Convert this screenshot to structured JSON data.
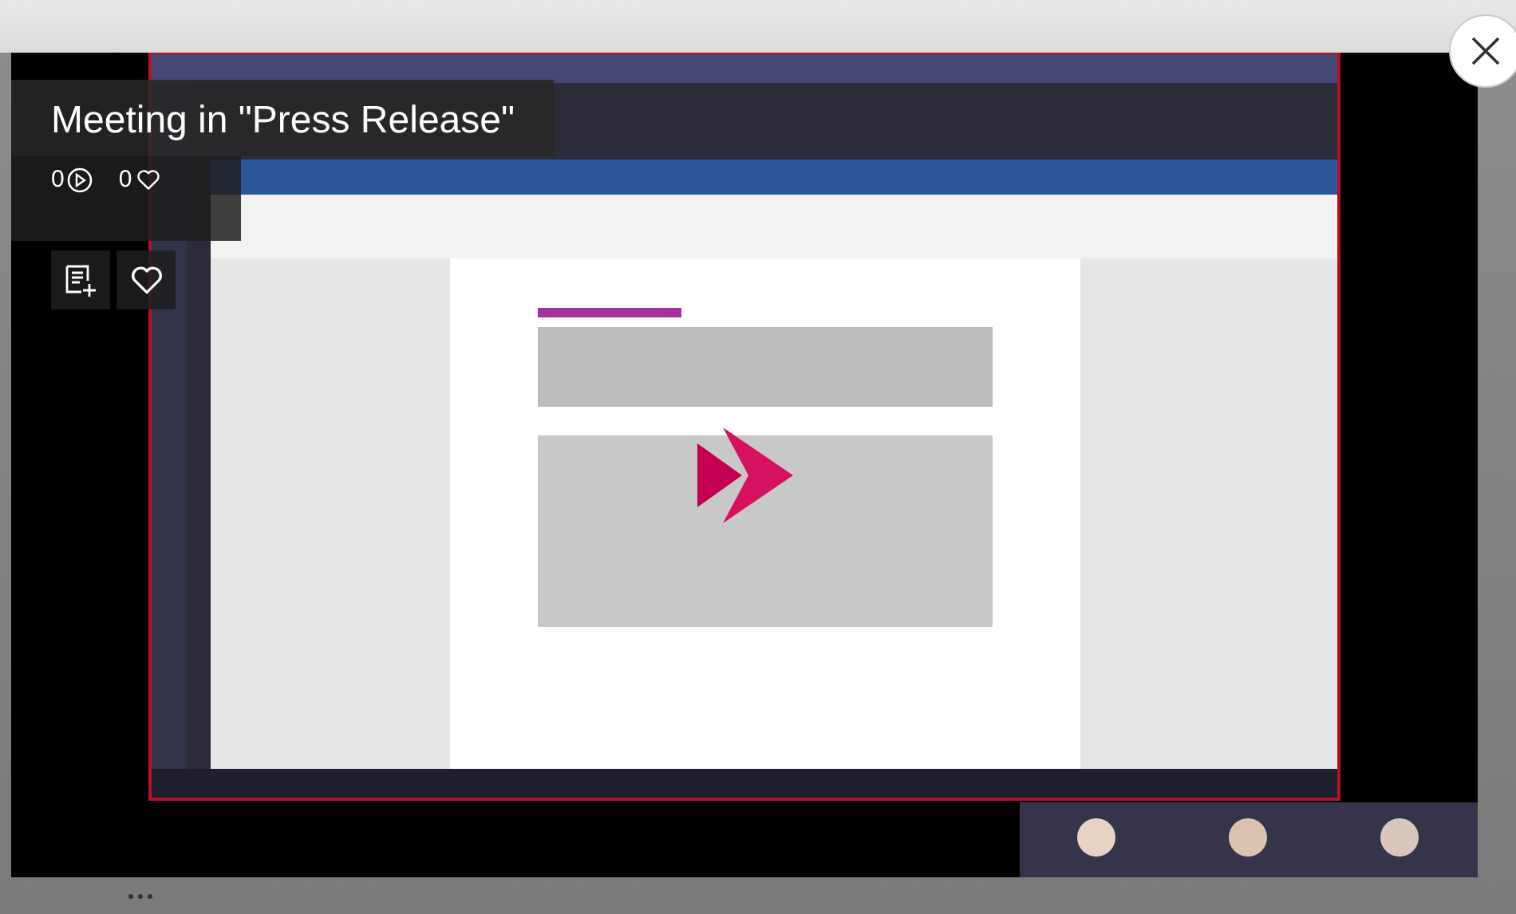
{
  "video": {
    "kind": "picture",
    "title": "Meeting in \"Press Release\"",
    "views": "0",
    "likes": "0"
  }
}
